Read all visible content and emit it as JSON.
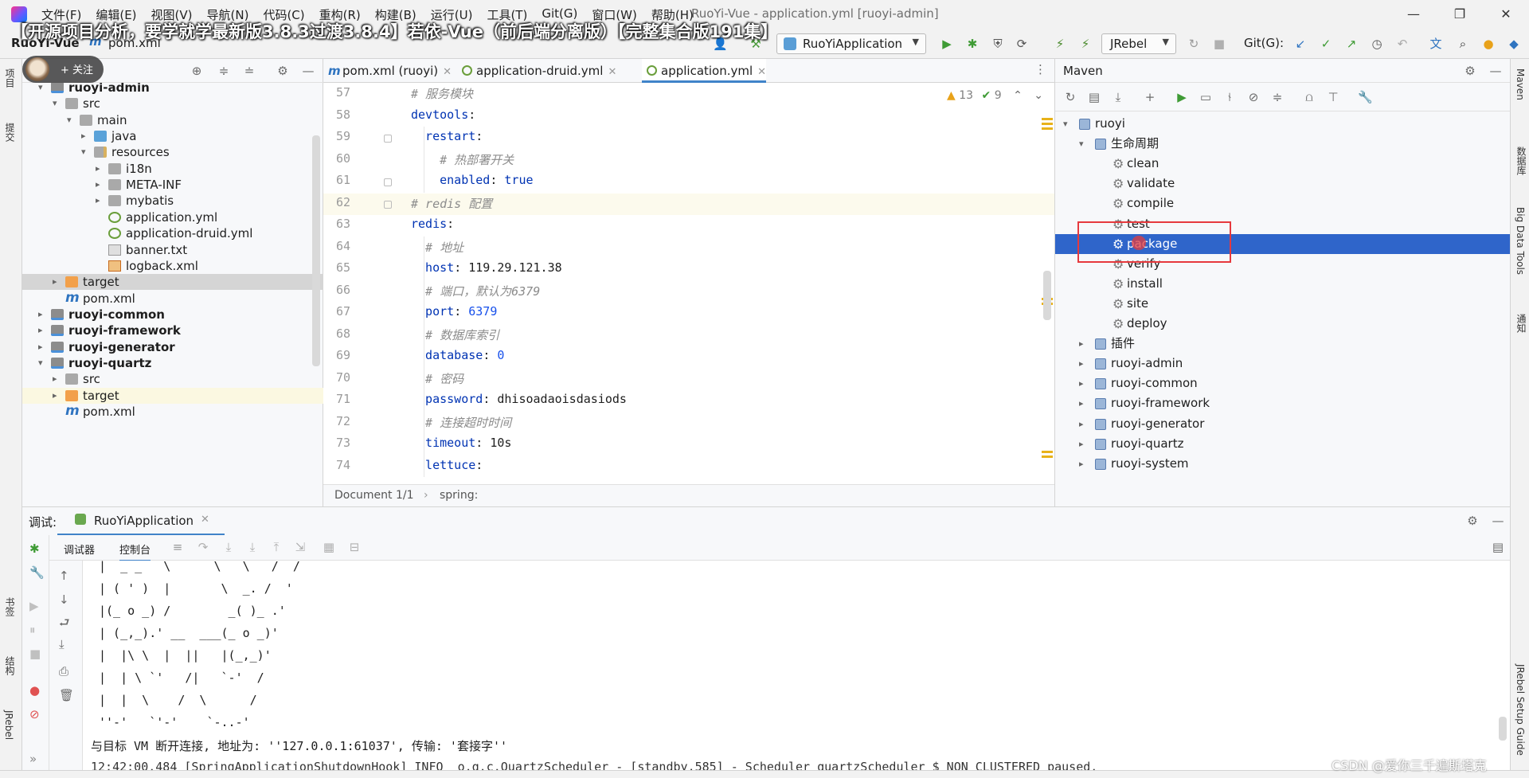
{
  "window": {
    "title": "RuoYi-Vue - application.yml [ruoyi-admin]",
    "menu": [
      "文件(F)",
      "编辑(E)",
      "视图(V)",
      "导航(N)",
      "代码(C)",
      "重构(R)",
      "构建(B)",
      "运行(U)",
      "工具(T)",
      "Git(G)",
      "窗口(W)",
      "帮助(H)"
    ],
    "controls": [
      "—",
      "❐",
      "✕"
    ]
  },
  "banner": "【开源项目分析，要学就学最新版3.8.3过渡3.8.4】若依-Vue（前后端分离版）【完整集合版191集】",
  "navbar": {
    "project": "RuoYi-Vue",
    "file": "pom.xml",
    "run_config": "RuoYiApplication",
    "jrebel": "JRebel",
    "git": "Git(G):"
  },
  "avatar_label": "+ 关注",
  "project_tree": [
    {
      "label": "ruoyi-admin",
      "bold": true,
      "icon": "module",
      "arrow": "▾"
    },
    {
      "label": "src",
      "icon": "src",
      "arrow": "▾"
    },
    {
      "label": "main",
      "icon": "folder",
      "arrow": "▾"
    },
    {
      "label": "java",
      "icon": "java",
      "arrow": "▸"
    },
    {
      "label": "resources",
      "icon": "res",
      "arrow": "▾"
    },
    {
      "label": "i18n",
      "icon": "folder",
      "arrow": "▸"
    },
    {
      "label": "META-INF",
      "icon": "folder",
      "arrow": "▸"
    },
    {
      "label": "mybatis",
      "icon": "folder",
      "arrow": "▸"
    },
    {
      "label": "application.yml",
      "icon": "yml"
    },
    {
      "label": "application-druid.yml",
      "icon": "yml"
    },
    {
      "label": "banner.txt",
      "icon": "txt"
    },
    {
      "label": "logback.xml",
      "icon": "xml"
    },
    {
      "label": "target",
      "icon": "target",
      "arrow": "▸",
      "state": "gray"
    },
    {
      "label": "pom.xml",
      "icon": "pom"
    },
    {
      "label": "ruoyi-common",
      "bold": true,
      "icon": "module",
      "arrow": "▸"
    },
    {
      "label": "ruoyi-framework",
      "bold": true,
      "icon": "module",
      "arrow": "▸"
    },
    {
      "label": "ruoyi-generator",
      "bold": true,
      "icon": "module",
      "arrow": "▸"
    },
    {
      "label": "ruoyi-quartz",
      "bold": true,
      "icon": "module",
      "arrow": "▾"
    },
    {
      "label": "src",
      "icon": "folder",
      "arrow": "▸"
    },
    {
      "label": "target",
      "icon": "target",
      "arrow": "▸",
      "state": "yellow"
    },
    {
      "label": "pom.xml",
      "icon": "pom"
    }
  ],
  "editor_tabs": [
    {
      "label": "pom.xml (ruoyi)",
      "icon": "pom"
    },
    {
      "label": "application-druid.yml",
      "icon": "yml"
    },
    {
      "label": "application.yml",
      "icon": "yml",
      "active": true
    }
  ],
  "editor": {
    "warnings": "13",
    "checks": "9",
    "lines": [
      {
        "n": "57",
        "parts": [
          {
            "t": "# 服务模块",
            "c": "cmt"
          }
        ]
      },
      {
        "n": "58",
        "parts": [
          {
            "t": "devtools",
            "c": "key"
          },
          {
            "t": ":",
            "c": ""
          }
        ]
      },
      {
        "n": "59",
        "parts": [
          {
            "t": "  restart",
            "c": "key"
          },
          {
            "t": ":",
            "c": ""
          }
        ]
      },
      {
        "n": "60",
        "parts": [
          {
            "t": "    # 热部署开关",
            "c": "cmt"
          }
        ]
      },
      {
        "n": "61",
        "parts": [
          {
            "t": "    enabled",
            "c": "key"
          },
          {
            "t": ": ",
            "c": ""
          },
          {
            "t": "true",
            "c": "key"
          }
        ]
      },
      {
        "n": "62",
        "parts": [
          {
            "t": "# redis 配置",
            "c": "cmt"
          }
        ],
        "current": true
      },
      {
        "n": "63",
        "parts": [
          {
            "t": "redis",
            "c": "key"
          },
          {
            "t": ":",
            "c": ""
          }
        ]
      },
      {
        "n": "64",
        "parts": [
          {
            "t": "  # 地址",
            "c": "cmt"
          }
        ]
      },
      {
        "n": "65",
        "parts": [
          {
            "t": "  host",
            "c": "key"
          },
          {
            "t": ": 119.29.121.38",
            "c": ""
          }
        ]
      },
      {
        "n": "66",
        "parts": [
          {
            "t": "  # 端口，默认为6379",
            "c": "cmt"
          }
        ]
      },
      {
        "n": "67",
        "parts": [
          {
            "t": "  port",
            "c": "key"
          },
          {
            "t": ": ",
            "c": ""
          },
          {
            "t": "6379",
            "c": "num"
          }
        ]
      },
      {
        "n": "68",
        "parts": [
          {
            "t": "  # 数据库索引",
            "c": "cmt"
          }
        ]
      },
      {
        "n": "69",
        "parts": [
          {
            "t": "  database",
            "c": "key"
          },
          {
            "t": ": ",
            "c": ""
          },
          {
            "t": "0",
            "c": "num"
          }
        ]
      },
      {
        "n": "70",
        "parts": [
          {
            "t": "  # 密码",
            "c": "cmt"
          }
        ]
      },
      {
        "n": "71",
        "parts": [
          {
            "t": "  password",
            "c": "key"
          },
          {
            "t": ": dhisoadaoisdasiods",
            "c": ""
          }
        ]
      },
      {
        "n": "72",
        "parts": [
          {
            "t": "  # 连接超时时间",
            "c": "cmt"
          }
        ]
      },
      {
        "n": "73",
        "parts": [
          {
            "t": "  timeout",
            "c": "key"
          },
          {
            "t": ": 10s",
            "c": ""
          }
        ]
      },
      {
        "n": "74",
        "parts": [
          {
            "t": "  lettuce",
            "c": "key"
          },
          {
            "t": ":",
            "c": ""
          }
        ]
      }
    ],
    "status_doc": "Document 1/1",
    "status_path": "spring:"
  },
  "maven": {
    "title": "Maven",
    "tree": [
      {
        "label": "ruoyi",
        "arrow": "▾",
        "kind": "root"
      },
      {
        "label": "生命周期",
        "arrow": "▾",
        "kind": "group"
      },
      {
        "label": "clean",
        "kind": "goal"
      },
      {
        "label": "validate",
        "kind": "goal"
      },
      {
        "label": "compile",
        "kind": "goal"
      },
      {
        "label": "test",
        "kind": "goal"
      },
      {
        "label": "package",
        "kind": "goal",
        "selected": true
      },
      {
        "label": "verify",
        "kind": "goal"
      },
      {
        "label": "install",
        "kind": "goal"
      },
      {
        "label": "site",
        "kind": "goal"
      },
      {
        "label": "deploy",
        "kind": "goal"
      },
      {
        "label": "插件",
        "arrow": "▸",
        "kind": "group"
      },
      {
        "label": "ruoyi-admin",
        "arrow": "▸",
        "kind": "module"
      },
      {
        "label": "ruoyi-common",
        "arrow": "▸",
        "kind": "module"
      },
      {
        "label": "ruoyi-framework",
        "arrow": "▸",
        "kind": "module"
      },
      {
        "label": "ruoyi-generator",
        "arrow": "▸",
        "kind": "module"
      },
      {
        "label": "ruoyi-quartz",
        "arrow": "▸",
        "kind": "module"
      },
      {
        "label": "ruoyi-system",
        "arrow": "▸",
        "kind": "module"
      }
    ]
  },
  "debug": {
    "label": "调试:",
    "session": "RuoYiApplication",
    "subtab_debugger": "调试器",
    "subtab_console": "控制台",
    "console_lines": [
      "|  _ _   \\      \\   \\   /  /",
      "| ( ' )  |       \\  _. /  '",
      "|(_ o _) /        _( )_ .'",
      "| (_,_).' __  ___(_ o _)'",
      "|  |\\ \\  |  ||   |(_,_)'",
      "|  | \\ `'   /|   `-'  /",
      "|  |  \\    /  \\      /",
      "''-'   `'-'    `-..-'",
      "与目标 VM 断开连接, 地址为: ''127.0.0.1:61037', 传输: '套接字''",
      "12:42:00.484 [SpringApplicationShutdownHook] INFO  o.q.c.QuartzScheduler - [standby,585] - Scheduler quartzScheduler_$_NON_CLUSTERED paused."
    ]
  },
  "side_tabs": {
    "left_top": "项目",
    "left_commit": "提交",
    "left_bookmarks": "书签",
    "left_structure": "结构",
    "left_jrebel": "JRebel",
    "right_maven": "Maven",
    "right_db": "数据库",
    "right_bigdata": "Big Data Tools",
    "right_notify": "通知",
    "right_jrebel_guide": "JRebel Setup Guide"
  },
  "watermark": "CSDN @爱你三千遍斯塔克",
  "colors": {
    "selection": "#2f65ca",
    "highlight_box": "#e6393d",
    "keyword": "#0033b3",
    "comment": "#8c8c8c"
  }
}
